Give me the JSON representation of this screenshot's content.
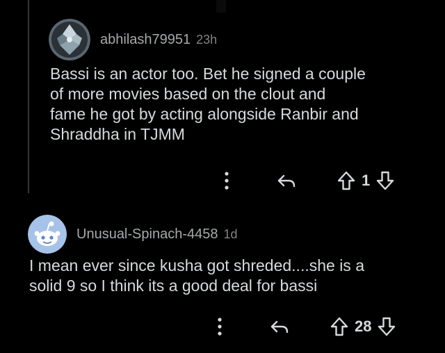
{
  "comments": [
    {
      "username": "abhilash79951",
      "age": "23h",
      "body": "Bassi is an actor too. Bet he signed a couple\nof more movies based on the clout and\nfame he got by acting alongside Ranbir and\nShraddha in TJMM",
      "score": "1",
      "avatar_icon": "crystal-avatar-icon"
    },
    {
      "username": "Unusual-Spinach-4458",
      "age": "1d",
      "body": "I mean ever since kusha got shreded....she is a\nsolid 9 so I think its a good deal for bassi",
      "score": "28",
      "avatar_icon": "snoo-avatar-icon"
    }
  ],
  "colors": {
    "background": "#000000",
    "text": "#d7dadc",
    "username": "#a7a9ab",
    "muted": "#818384",
    "thread_line": "#343536",
    "snoo_avatar_bg": "#a7c2e8"
  }
}
